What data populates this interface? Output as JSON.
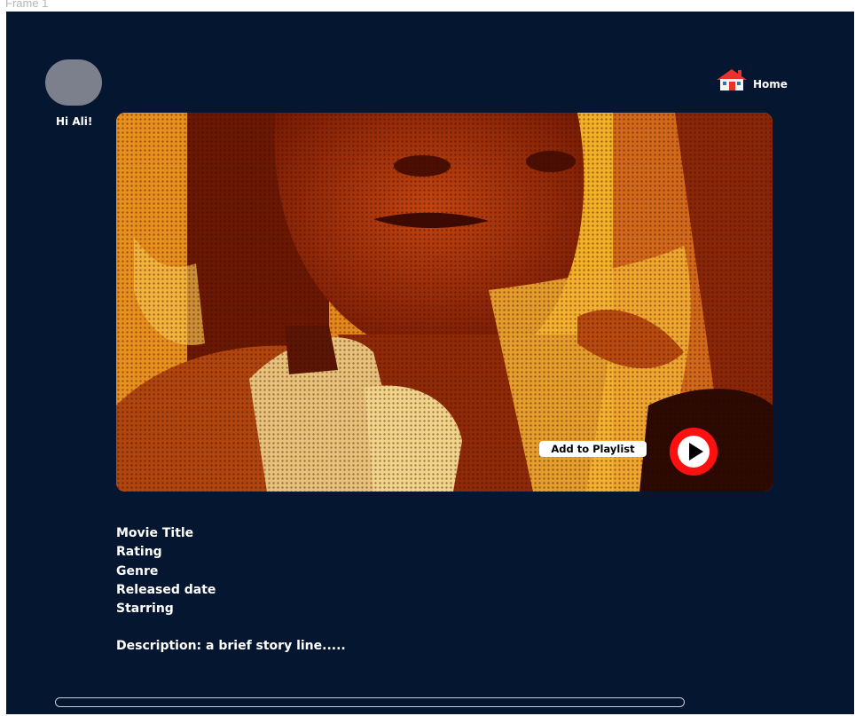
{
  "frame": {
    "label": "Frame 1"
  },
  "user": {
    "greeting": "Hi Ali!"
  },
  "nav": {
    "home_label": "Home",
    "home_icon": "house-icon"
  },
  "hero": {
    "add_to_playlist_label": "Add to Playlist",
    "play_icon": "play-icon"
  },
  "details": {
    "title": "Movie Title",
    "rating": "Rating",
    "genre": "Genre",
    "released": "Released date",
    "starring": "Starring",
    "description": "Description:  a brief story line....."
  },
  "colors": {
    "background": "#051630",
    "accent": "#ff1010",
    "avatar": "#7b808c"
  }
}
